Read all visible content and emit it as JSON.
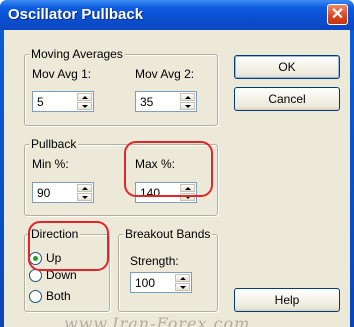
{
  "window": {
    "title": "Oscillator Pullback",
    "close_glyph": "✕"
  },
  "moving_averages": {
    "legend": "Moving Averages",
    "mov_avg_1": {
      "label": "Mov Avg 1:",
      "value": "5"
    },
    "mov_avg_2": {
      "label": "Mov Avg 2:",
      "value": "35"
    }
  },
  "pullback": {
    "legend": "Pullback",
    "min": {
      "label": "Min %:",
      "value": "90"
    },
    "max": {
      "label": "Max %:",
      "value": "140"
    }
  },
  "direction": {
    "legend": "Direction",
    "options": [
      {
        "label": "Up",
        "selected": true
      },
      {
        "label": "Down",
        "selected": false
      },
      {
        "label": "Both",
        "selected": false
      }
    ]
  },
  "breakout_bands": {
    "legend": "Breakout Bands",
    "strength": {
      "label": "Strength:",
      "value": "100"
    }
  },
  "buttons": {
    "ok": "OK",
    "cancel": "Cancel",
    "help": "Help"
  },
  "watermark": "www.Iran-Forex.com",
  "colors": {
    "titlebar": "#0a4fd0",
    "dialog_bg": "#ece9d8",
    "highlight_ring": "#e1262a"
  }
}
